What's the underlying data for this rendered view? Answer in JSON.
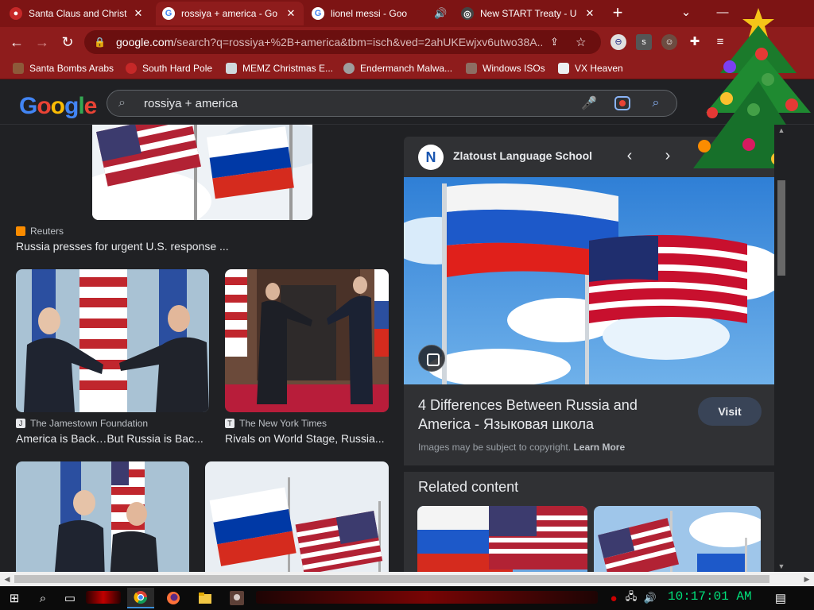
{
  "browser": {
    "tabs": [
      {
        "title": "Santa Claus and Christ",
        "active": false
      },
      {
        "title": "rossiya + america - Go",
        "active": true
      },
      {
        "title": "lionel messi - Goo",
        "active": false
      },
      {
        "title": "New START Treaty - U",
        "active": false
      }
    ],
    "url_host": "google.com",
    "url_rest": "/search?q=rossiya+%2B+america&tbm=isch&ved=2ahUKEwjxv6utwo38A...",
    "bookmarks": [
      {
        "label": "Santa Bombs Arabs",
        "icon": "figure-icon"
      },
      {
        "label": "South Hard Pole",
        "icon": "flower-icon"
      },
      {
        "label": "MEMZ Christmas E...",
        "icon": "image-icon"
      },
      {
        "label": "Endermanch Malwa...",
        "icon": "skull-icon"
      },
      {
        "label": "Windows ISOs",
        "icon": "figure-icon"
      },
      {
        "label": "VX Heaven",
        "icon": "ghost-icon"
      }
    ]
  },
  "search": {
    "logo": "Google",
    "query": "rossiya + america"
  },
  "results": [
    {
      "source": "Reuters",
      "caption": "Russia presses for urgent U.S. response ..."
    },
    {
      "source": "The Jamestown Foundation",
      "caption": "America is Back…But Russia is Bac..."
    },
    {
      "source": "The New York Times",
      "caption": "Rivals on World Stage, Russia..."
    }
  ],
  "panel": {
    "site_name": "Zlatoust Language School",
    "site_initial": "N",
    "title": "4 Differences Between Russia and America - Языковая школа",
    "visit_label": "Visit",
    "copyright": "Images may be subject to copyright.",
    "learn_more": "Learn More",
    "related_heading": "Related content"
  },
  "taskbar": {
    "clock": "10:17:01 AM"
  },
  "colors": {
    "chrome_red": "#8e1c1c",
    "google_bg": "#202124",
    "panel_bg": "#303134",
    "clock_green": "#00e07a"
  }
}
